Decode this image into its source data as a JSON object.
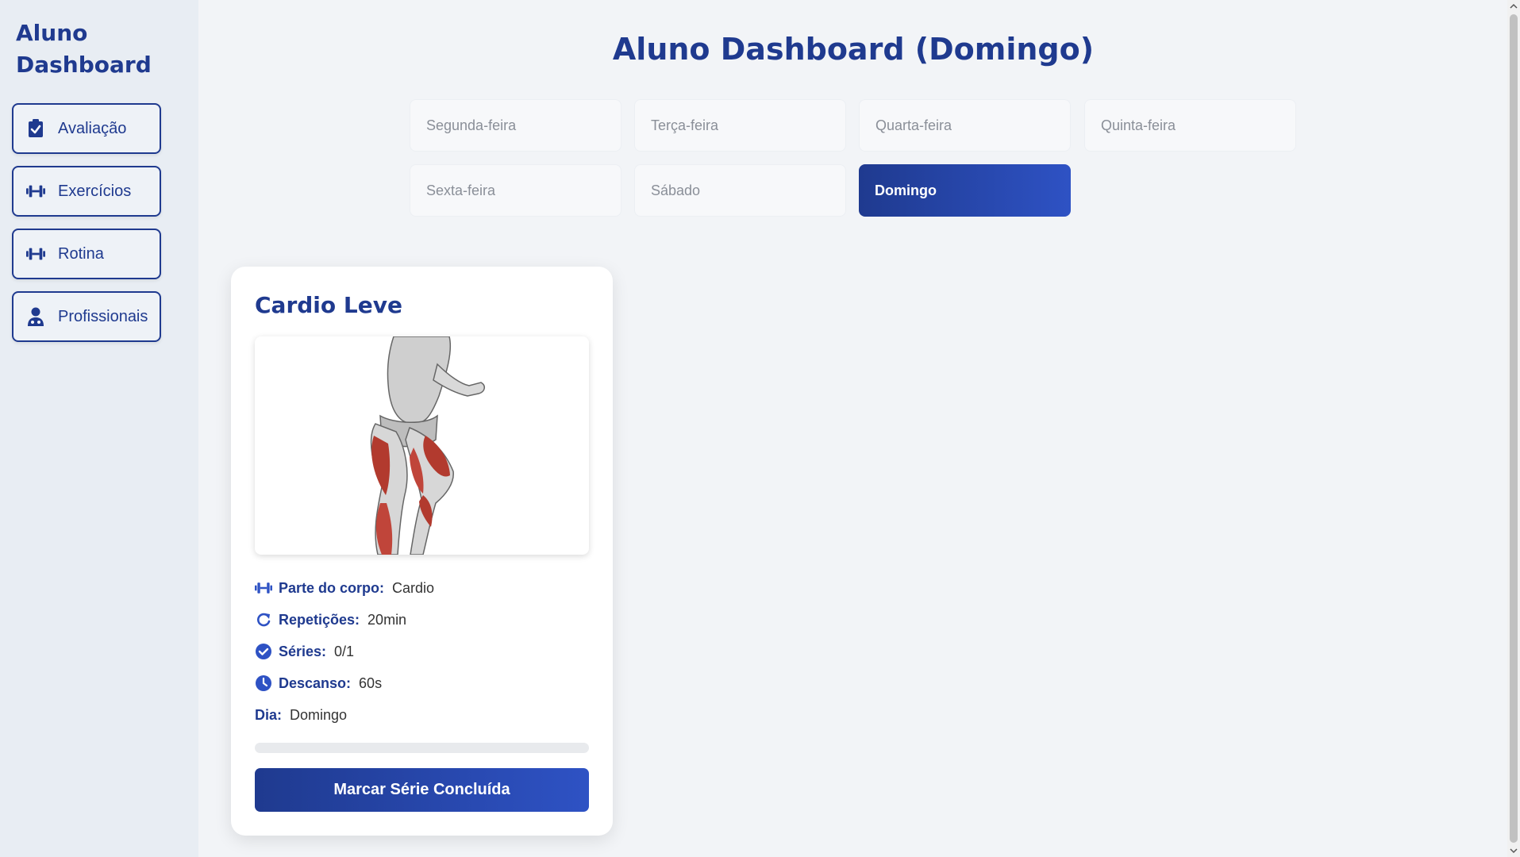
{
  "sidebar": {
    "title": "Aluno Dashboard",
    "items": [
      {
        "label": "Avaliação",
        "icon": "clipboard-check-icon"
      },
      {
        "label": "Exercícios",
        "icon": "dumbbell-icon"
      },
      {
        "label": "Rotina",
        "icon": "dumbbell-icon"
      },
      {
        "label": "Profissionais",
        "icon": "user-doctor-icon"
      }
    ]
  },
  "main": {
    "title": "Aluno Dashboard (Domingo)",
    "days": [
      "Segunda-feira",
      "Terça-feira",
      "Quarta-feira",
      "Quinta-feira",
      "Sexta-feira",
      "Sábado",
      "Domingo"
    ],
    "active_day": "Domingo"
  },
  "card": {
    "title": "Cardio Leve",
    "image_alt": "muscle-anatomy-illustration",
    "fields": {
      "body_part": {
        "label": "Parte do corpo:",
        "value": "Cardio",
        "icon": "dumbbell-icon"
      },
      "reps": {
        "label": "Repetições:",
        "value": "20min",
        "icon": "redo-icon"
      },
      "series": {
        "label": "Séries:",
        "value": "0/1",
        "icon": "check-circle-icon"
      },
      "rest": {
        "label": "Descanso:",
        "value": "60s",
        "icon": "clock-icon"
      },
      "day": {
        "label": "Dia:",
        "value": "Domingo"
      }
    },
    "progress_fraction": 0,
    "button_label": "Marcar Série Concluída"
  },
  "colors": {
    "primary": "#1f3a8f",
    "accent": "#2e52c4",
    "background": "#f2f4f7",
    "sidebar": "#e8edf3"
  }
}
